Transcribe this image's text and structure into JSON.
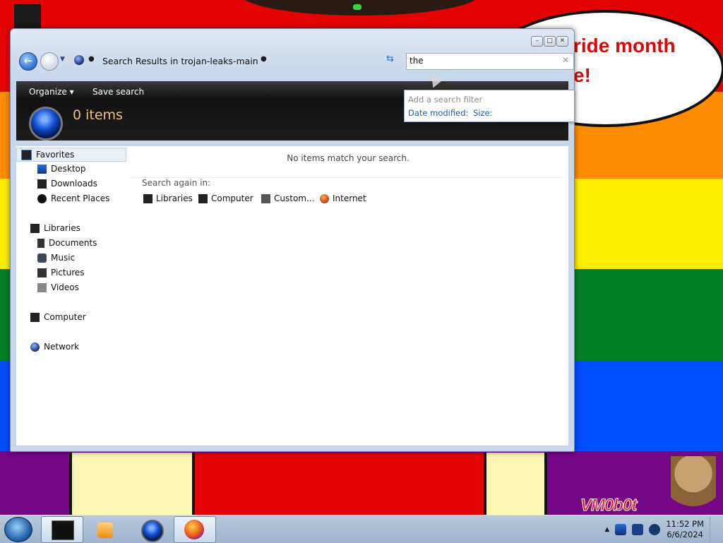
{
  "desktop": {
    "bubble_lines": [
      "ride month",
      "e!"
    ],
    "watermark": "VM0b0t"
  },
  "window": {
    "address": "Search Results in trojan-leaks-main",
    "search_value": "the",
    "filter_popup": {
      "hint": "Add a search filter",
      "options": [
        "Date modified:",
        "Size:"
      ]
    },
    "toolbar": {
      "organize": "Organize ▾",
      "save_search": "Save search"
    },
    "items_count": "0 items",
    "nav": {
      "favorites": "Favorites",
      "desktop": "Desktop",
      "downloads": "Downloads",
      "recent_places": "Recent Places",
      "libraries": "Libraries",
      "documents": "Documents",
      "music": "Music",
      "pictures": "Pictures",
      "videos": "Videos",
      "computer": "Computer",
      "network": "Network"
    },
    "content": {
      "no_items": "No items match your search.",
      "search_again_label": "Search again in:",
      "search_again": [
        "Libraries",
        "Computer",
        "Custom...",
        "Internet"
      ]
    }
  },
  "taskbar": {
    "time": "11:52 PM",
    "date": "6/6/2024"
  }
}
